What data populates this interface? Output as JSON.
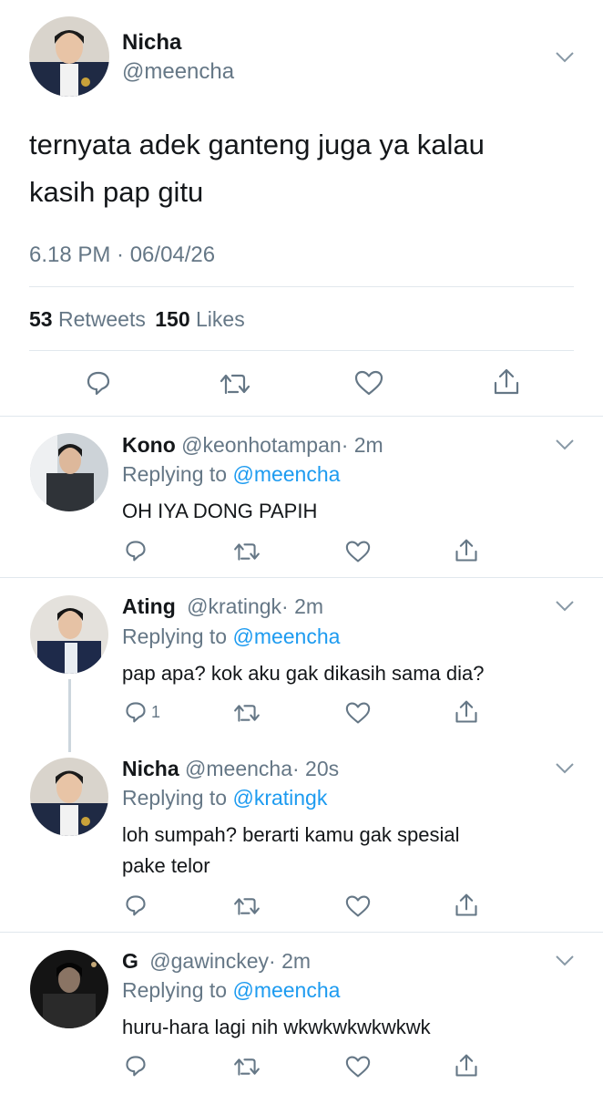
{
  "main_tweet": {
    "name": "Nicha",
    "handle": "@meencha",
    "text_line1": "ternyata adek ganteng juga ya kalau",
    "text_line2": "kasih pap gitu",
    "timestamp": "6.18 PM · 06/04/26",
    "retweets_count": "53",
    "retweets_label": "Retweets",
    "likes_count": "150",
    "likes_label": "Likes"
  },
  "replies": [
    {
      "name": "Kono",
      "handle": "@keonhotampan",
      "time": "· 2m",
      "replying_prefix": "Replying to",
      "replying_to": "@meencha",
      "text_line1": "OH IYA DONG PAPIH",
      "text_line2": ""
    },
    {
      "name": "Ating",
      "handle": "@kratingk",
      "time": "· 2m",
      "replying_prefix": "Replying to",
      "replying_to": "@meencha",
      "text_line1": "pap apa? kok aku gak dikasih sama dia?",
      "text_line2": "",
      "reply_count": "1"
    },
    {
      "name": "Nicha",
      "handle": "@meencha",
      "time": "· 20s",
      "replying_prefix": "Replying to",
      "replying_to": "@kratingk",
      "text_line1": "loh sumpah? berarti kamu gak spesial",
      "text_line2": "pake telor"
    },
    {
      "name": "G",
      "handle": "@gawinckey",
      "time": "· 2m",
      "replying_prefix": "Replying to",
      "replying_to": "@meencha",
      "text_line1": "huru-hara lagi nih wkwkwkwkwkwk",
      "text_line2": ""
    }
  ],
  "icons": [
    "reply-icon",
    "retweet-icon",
    "like-icon",
    "share-icon",
    "chevron-down-icon"
  ],
  "colors": {
    "link": "#1d9bf0",
    "secondary": "#657786",
    "divider": "#e1e8ed"
  }
}
